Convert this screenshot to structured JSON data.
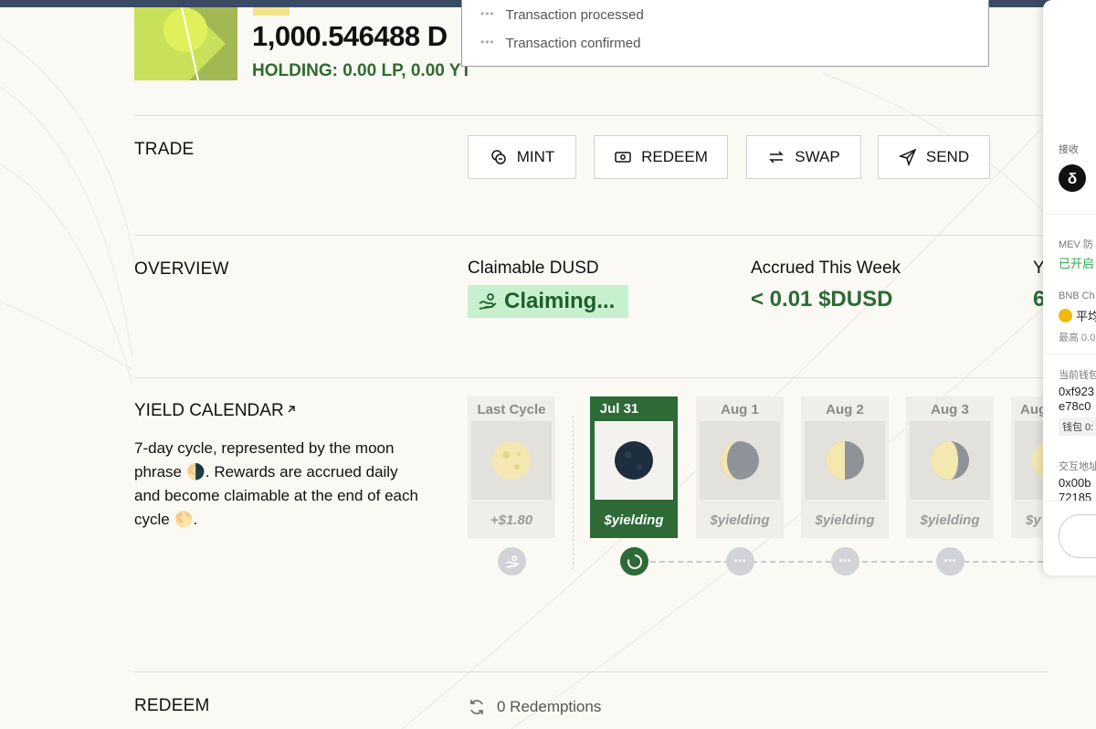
{
  "header": {
    "balance": "1,000.546488 D",
    "holding": "HOLDING: 0.00 LP, 0.00 YT"
  },
  "toast": {
    "items": [
      {
        "status_icon": "ellipsis-icon",
        "text": "Transaction processed"
      },
      {
        "status_icon": "ellipsis-icon",
        "text": "Transaction confirmed"
      }
    ]
  },
  "trade": {
    "label": "TRADE",
    "buttons": [
      {
        "label": "MINT",
        "icon": "coins-icon"
      },
      {
        "label": "REDEEM",
        "icon": "banknote-icon"
      },
      {
        "label": "SWAP",
        "icon": "swap-arrows-icon"
      },
      {
        "label": "SEND",
        "icon": "send-icon"
      }
    ]
  },
  "overview": {
    "label": "OVERVIEW",
    "claimable_label": "Claimable DUSD",
    "claimable_value": "Claiming...",
    "accrued_label": "Accrued This Week",
    "accrued_value": "< 0.01 $DUSD",
    "third_label_partial": "Y",
    "third_value_partial": "6"
  },
  "calendar": {
    "title": "YIELD CALENDAR",
    "description": "7-day cycle, represented by the moon phrase 🌗. Rewards are accrued daily and become claimable at the end of each cycle 🌕.",
    "cards": [
      {
        "label": "Last Cycle",
        "value": "+$1.80",
        "moon": "full-moon-icon"
      },
      {
        "label": "Jul 31",
        "value": "$yielding",
        "moon": "new-moon-icon"
      },
      {
        "label": "Aug 1",
        "value": "$yielding",
        "moon": "waxing-crescent-icon"
      },
      {
        "label": "Aug 2",
        "value": "$yielding",
        "moon": "first-quarter-icon"
      },
      {
        "label": "Aug 3",
        "value": "$yielding",
        "moon": "waxing-gibbous-icon"
      },
      {
        "label": "Aug",
        "value": "$y",
        "moon": "moon-icon"
      }
    ]
  },
  "redeem": {
    "label": "REDEEM",
    "count": "0 Redemptions"
  },
  "wallet_panel": {
    "receive_label": "接收",
    "mev_label": "MEV 防",
    "mev_status": "已开启",
    "chain_label": "BNB Ch",
    "chain_value": "平均",
    "max_label": "最高 0.0",
    "current_wallet_label": "当前钱包",
    "address_line1": "0xf923",
    "address_line2": "e78c0",
    "wallet_badge": "钱包 0:",
    "interact_label": "交互地址",
    "interact_line1": "0x00b",
    "interact_line2": "72185"
  },
  "colors": {
    "accent_green": "#2d6a36",
    "claiming_bg": "#c7f0cf",
    "logo_green": "#a2b953"
  }
}
